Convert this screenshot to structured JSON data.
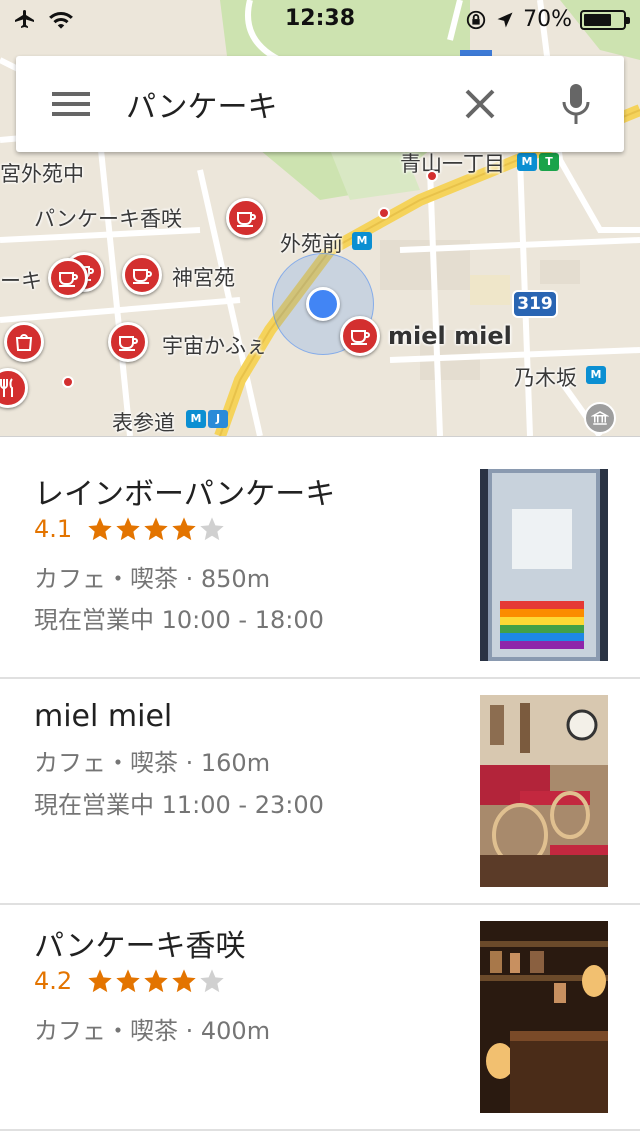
{
  "status_bar": {
    "time": "12:38",
    "battery": "70%",
    "battery_level": 0.7
  },
  "search": {
    "query": "パンケーキ",
    "icons": [
      "menu-icon",
      "close-icon",
      "mic-icon"
    ]
  },
  "map": {
    "labels": {
      "gaien_naka": "宮外苑中",
      "aoyama": "青山一丁目",
      "kousaku": "パンケーキ香咲",
      "gaienmae": "外苑前",
      "jingu": "神宮苑",
      "kie": "ーキ",
      "uchu": "宇宙かふぇ",
      "mielmiel": "miel miel",
      "nogizaka": "乃木坂",
      "omotesando": "表参道",
      "route": "319"
    },
    "colors": {
      "pin": "#d32f2f",
      "location": "#4285f4"
    }
  },
  "results": [
    {
      "title": "レインボーパンケーキ",
      "rating": "4.1",
      "stars": 4,
      "category": "カフェ・喫茶 · 850m",
      "hours": "現在営業中 10:00 - 18:00"
    },
    {
      "title": "miel miel",
      "category": "カフェ・喫茶 · 160m",
      "hours": "現在営業中 11:00 - 23:00"
    },
    {
      "title": "パンケーキ香咲",
      "rating": "4.2",
      "stars": 4,
      "category": "カフェ・喫茶 · 400m"
    }
  ],
  "colors": {
    "rating": "#e37400",
    "star_on": "#e37400",
    "star_off": "#d0d0d0"
  }
}
